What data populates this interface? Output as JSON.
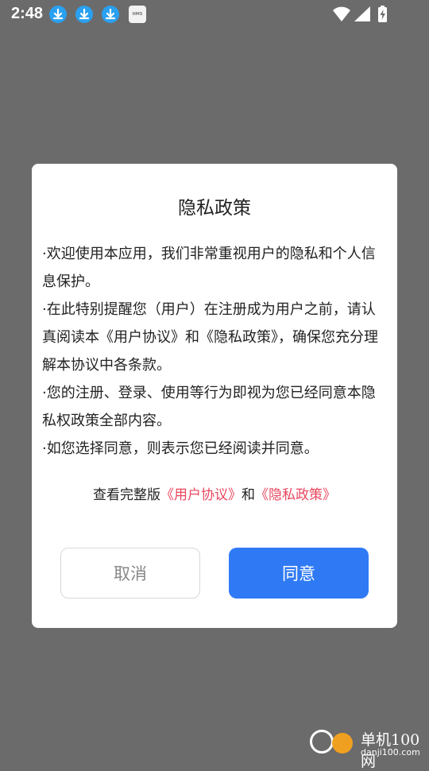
{
  "status_bar": {
    "time": "2:48",
    "notification_icons": [
      "download-icon",
      "download-icon",
      "download-icon",
      "hms-icon"
    ],
    "hms_label": "HMS",
    "system_icons": [
      "wifi-icon",
      "signal-icon",
      "battery-charging-icon"
    ]
  },
  "dialog": {
    "title": "隐私政策",
    "paragraphs": [
      "·欢迎使用本应用，我们非常重视用户的隐私和个人信息保护。",
      "·在此特别提醒您（用户）在注册成为用户之前，请认真阅读本《用户协议》和《隐私政策》，确保您充分理解本协议中各条款。",
      "·您的注册、登录、使用等行为即视为您已经同意本隐私权政策全部内容。",
      "·如您选择同意，则表示您已经阅读并同意。"
    ],
    "links_prefix": "查看完整版",
    "link_user_agreement": "《用户协议》",
    "links_and": "和",
    "link_privacy_policy": "《隐私政策》",
    "cancel_label": "取消",
    "agree_label": "同意"
  },
  "watermark": {
    "text": "单机100网",
    "sub": "danji100.com"
  },
  "colors": {
    "overlay": "#6b6b6b",
    "link": "#e8475f",
    "primary_button": "#2f7af4"
  }
}
